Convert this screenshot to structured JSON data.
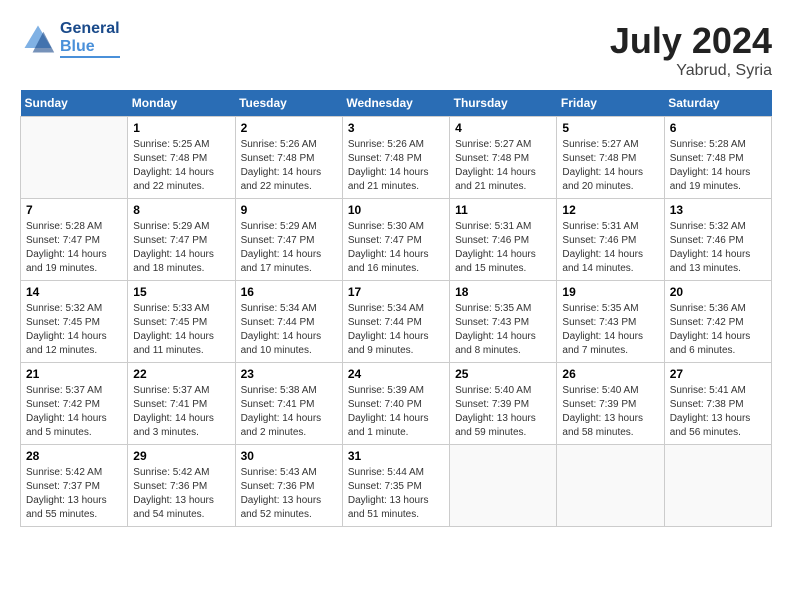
{
  "header": {
    "logo_general": "General",
    "logo_blue": "Blue",
    "month_year": "July 2024",
    "location": "Yabrud, Syria"
  },
  "days_of_week": [
    "Sunday",
    "Monday",
    "Tuesday",
    "Wednesday",
    "Thursday",
    "Friday",
    "Saturday"
  ],
  "weeks": [
    [
      {
        "day": "",
        "empty": true
      },
      {
        "day": "1",
        "sunrise": "Sunrise: 5:25 AM",
        "sunset": "Sunset: 7:48 PM",
        "daylight": "Daylight: 14 hours and 22 minutes."
      },
      {
        "day": "2",
        "sunrise": "Sunrise: 5:26 AM",
        "sunset": "Sunset: 7:48 PM",
        "daylight": "Daylight: 14 hours and 22 minutes."
      },
      {
        "day": "3",
        "sunrise": "Sunrise: 5:26 AM",
        "sunset": "Sunset: 7:48 PM",
        "daylight": "Daylight: 14 hours and 21 minutes."
      },
      {
        "day": "4",
        "sunrise": "Sunrise: 5:27 AM",
        "sunset": "Sunset: 7:48 PM",
        "daylight": "Daylight: 14 hours and 21 minutes."
      },
      {
        "day": "5",
        "sunrise": "Sunrise: 5:27 AM",
        "sunset": "Sunset: 7:48 PM",
        "daylight": "Daylight: 14 hours and 20 minutes."
      },
      {
        "day": "6",
        "sunrise": "Sunrise: 5:28 AM",
        "sunset": "Sunset: 7:48 PM",
        "daylight": "Daylight: 14 hours and 19 minutes."
      }
    ],
    [
      {
        "day": "7",
        "sunrise": "Sunrise: 5:28 AM",
        "sunset": "Sunset: 7:47 PM",
        "daylight": "Daylight: 14 hours and 19 minutes."
      },
      {
        "day": "8",
        "sunrise": "Sunrise: 5:29 AM",
        "sunset": "Sunset: 7:47 PM",
        "daylight": "Daylight: 14 hours and 18 minutes."
      },
      {
        "day": "9",
        "sunrise": "Sunrise: 5:29 AM",
        "sunset": "Sunset: 7:47 PM",
        "daylight": "Daylight: 14 hours and 17 minutes."
      },
      {
        "day": "10",
        "sunrise": "Sunrise: 5:30 AM",
        "sunset": "Sunset: 7:47 PM",
        "daylight": "Daylight: 14 hours and 16 minutes."
      },
      {
        "day": "11",
        "sunrise": "Sunrise: 5:31 AM",
        "sunset": "Sunset: 7:46 PM",
        "daylight": "Daylight: 14 hours and 15 minutes."
      },
      {
        "day": "12",
        "sunrise": "Sunrise: 5:31 AM",
        "sunset": "Sunset: 7:46 PM",
        "daylight": "Daylight: 14 hours and 14 minutes."
      },
      {
        "day": "13",
        "sunrise": "Sunrise: 5:32 AM",
        "sunset": "Sunset: 7:46 PM",
        "daylight": "Daylight: 14 hours and 13 minutes."
      }
    ],
    [
      {
        "day": "14",
        "sunrise": "Sunrise: 5:32 AM",
        "sunset": "Sunset: 7:45 PM",
        "daylight": "Daylight: 14 hours and 12 minutes."
      },
      {
        "day": "15",
        "sunrise": "Sunrise: 5:33 AM",
        "sunset": "Sunset: 7:45 PM",
        "daylight": "Daylight: 14 hours and 11 minutes."
      },
      {
        "day": "16",
        "sunrise": "Sunrise: 5:34 AM",
        "sunset": "Sunset: 7:44 PM",
        "daylight": "Daylight: 14 hours and 10 minutes."
      },
      {
        "day": "17",
        "sunrise": "Sunrise: 5:34 AM",
        "sunset": "Sunset: 7:44 PM",
        "daylight": "Daylight: 14 hours and 9 minutes."
      },
      {
        "day": "18",
        "sunrise": "Sunrise: 5:35 AM",
        "sunset": "Sunset: 7:43 PM",
        "daylight": "Daylight: 14 hours and 8 minutes."
      },
      {
        "day": "19",
        "sunrise": "Sunrise: 5:35 AM",
        "sunset": "Sunset: 7:43 PM",
        "daylight": "Daylight: 14 hours and 7 minutes."
      },
      {
        "day": "20",
        "sunrise": "Sunrise: 5:36 AM",
        "sunset": "Sunset: 7:42 PM",
        "daylight": "Daylight: 14 hours and 6 minutes."
      }
    ],
    [
      {
        "day": "21",
        "sunrise": "Sunrise: 5:37 AM",
        "sunset": "Sunset: 7:42 PM",
        "daylight": "Daylight: 14 hours and 5 minutes."
      },
      {
        "day": "22",
        "sunrise": "Sunrise: 5:37 AM",
        "sunset": "Sunset: 7:41 PM",
        "daylight": "Daylight: 14 hours and 3 minutes."
      },
      {
        "day": "23",
        "sunrise": "Sunrise: 5:38 AM",
        "sunset": "Sunset: 7:41 PM",
        "daylight": "Daylight: 14 hours and 2 minutes."
      },
      {
        "day": "24",
        "sunrise": "Sunrise: 5:39 AM",
        "sunset": "Sunset: 7:40 PM",
        "daylight": "Daylight: 14 hours and 1 minute."
      },
      {
        "day": "25",
        "sunrise": "Sunrise: 5:40 AM",
        "sunset": "Sunset: 7:39 PM",
        "daylight": "Daylight: 13 hours and 59 minutes."
      },
      {
        "day": "26",
        "sunrise": "Sunrise: 5:40 AM",
        "sunset": "Sunset: 7:39 PM",
        "daylight": "Daylight: 13 hours and 58 minutes."
      },
      {
        "day": "27",
        "sunrise": "Sunrise: 5:41 AM",
        "sunset": "Sunset: 7:38 PM",
        "daylight": "Daylight: 13 hours and 56 minutes."
      }
    ],
    [
      {
        "day": "28",
        "sunrise": "Sunrise: 5:42 AM",
        "sunset": "Sunset: 7:37 PM",
        "daylight": "Daylight: 13 hours and 55 minutes."
      },
      {
        "day": "29",
        "sunrise": "Sunrise: 5:42 AM",
        "sunset": "Sunset: 7:36 PM",
        "daylight": "Daylight: 13 hours and 54 minutes."
      },
      {
        "day": "30",
        "sunrise": "Sunrise: 5:43 AM",
        "sunset": "Sunset: 7:36 PM",
        "daylight": "Daylight: 13 hours and 52 minutes."
      },
      {
        "day": "31",
        "sunrise": "Sunrise: 5:44 AM",
        "sunset": "Sunset: 7:35 PM",
        "daylight": "Daylight: 13 hours and 51 minutes."
      },
      {
        "day": "",
        "empty": true
      },
      {
        "day": "",
        "empty": true
      },
      {
        "day": "",
        "empty": true
      }
    ]
  ]
}
